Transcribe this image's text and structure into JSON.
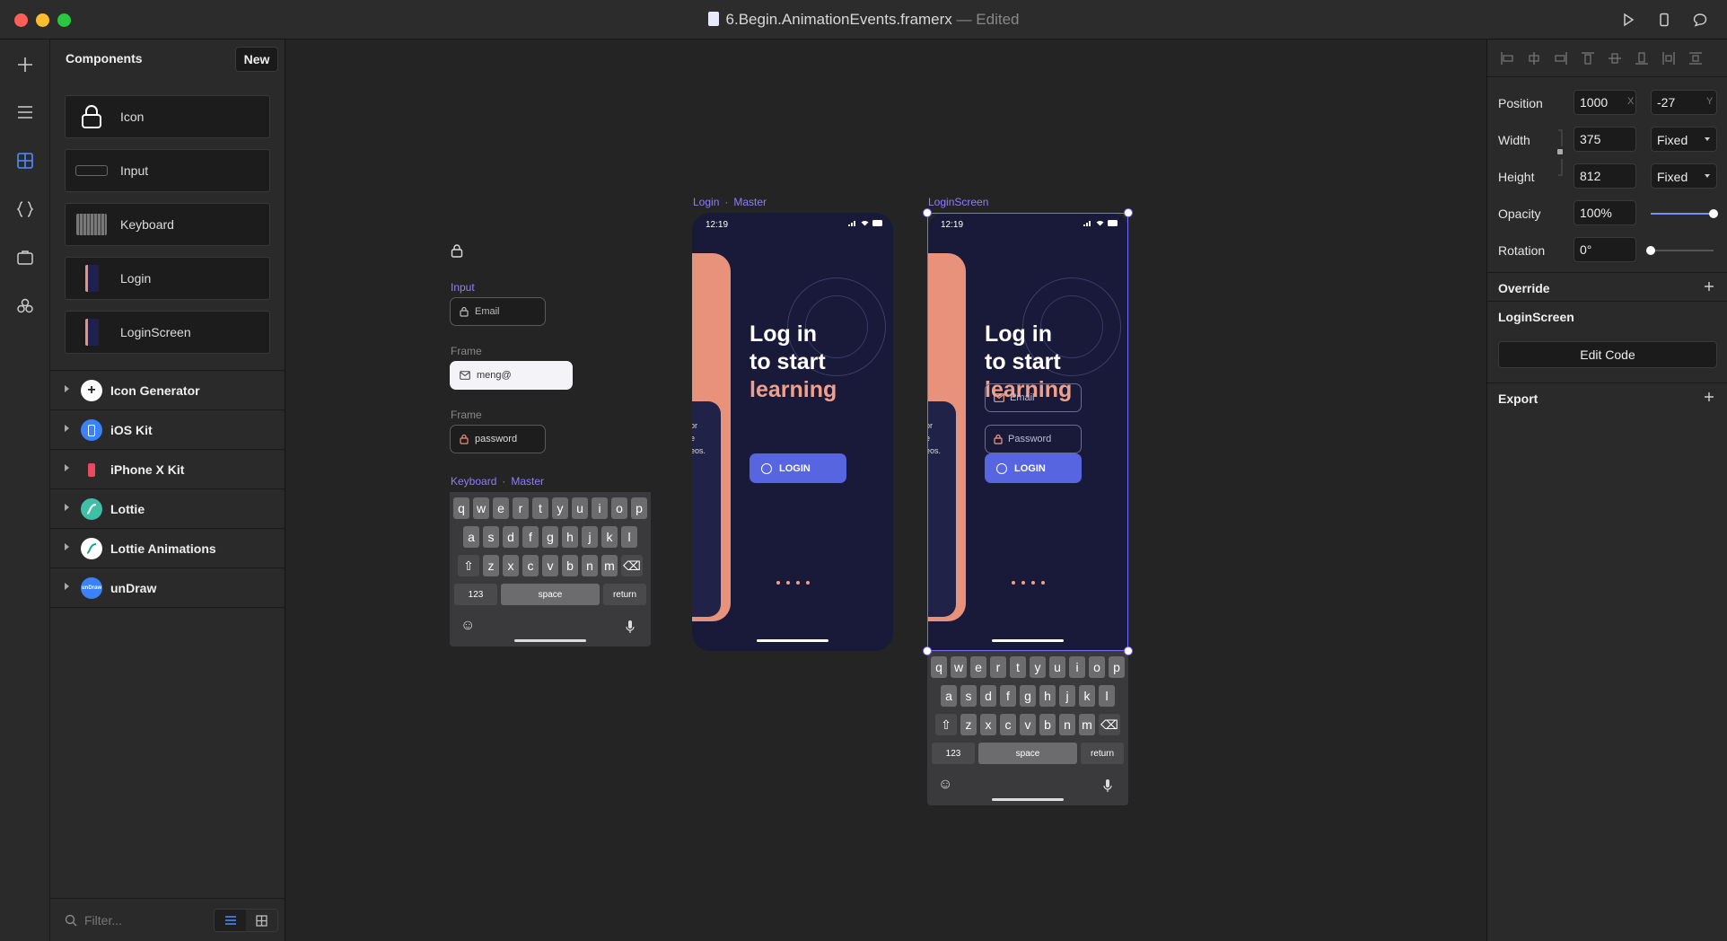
{
  "window": {
    "title": "6.Begin.AnimationEvents.framerx",
    "edited_suffix": "— Edited"
  },
  "components_panel": {
    "title": "Components",
    "new_label": "New",
    "items": [
      {
        "label": "Icon"
      },
      {
        "label": "Input"
      },
      {
        "label": "Keyboard"
      },
      {
        "label": "Login"
      },
      {
        "label": "LoginScreen"
      }
    ],
    "packages": [
      {
        "label": "Icon Generator",
        "icon_text": "+",
        "color": "#ffffff"
      },
      {
        "label": "iOS Kit",
        "icon_text": "",
        "color": "#3b82f6"
      },
      {
        "label": "iPhone X Kit",
        "icon_text": "",
        "color": "#2a2a2a"
      },
      {
        "label": "Lottie",
        "icon_text": "",
        "color": "#3fc0a6"
      },
      {
        "label": "Lottie Animations",
        "icon_text": "",
        "color": "#ffffff"
      },
      {
        "label": "unDraw",
        "icon_text": "unDraw",
        "color": "#3b82f6"
      }
    ],
    "filter_placeholder": "Filter..."
  },
  "canvas": {
    "input_label": "Input",
    "input_placeholder": "Email",
    "frame_label_1": "Frame",
    "frame_value_1": "meng@",
    "frame_label_2": "Frame",
    "frame_value_2": "password",
    "keyboard_label": "Keyboard",
    "keyboard_master": "Master",
    "login_label": "Login",
    "login_master": "Master",
    "loginscreen_label": "LoginScreen",
    "keys_row1": [
      "q",
      "w",
      "e",
      "r",
      "t",
      "y",
      "u",
      "i",
      "o",
      "p"
    ],
    "keys_row2": [
      "a",
      "s",
      "d",
      "f",
      "g",
      "h",
      "j",
      "k",
      "l"
    ],
    "keys_row3": [
      "z",
      "x",
      "c",
      "v",
      "b",
      "n",
      "m"
    ],
    "key_123": "123",
    "key_space": "space",
    "key_return": "return",
    "phone": {
      "time": "12:19",
      "line1": "Log in",
      "line2": "to start",
      "line3": "learning",
      "card_text_1": "or",
      "card_text_2": "e",
      "card_text_3": "eos.",
      "email_placeholder": "Email",
      "password_placeholder": "Password",
      "login_button": "LOGIN"
    }
  },
  "properties": {
    "position_label": "Position",
    "position_x": "1000",
    "position_y": "-27",
    "x_suffix": "X",
    "y_suffix": "Y",
    "width_label": "Width",
    "width_value": "375",
    "width_mode": "Fixed",
    "height_label": "Height",
    "height_value": "812",
    "height_mode": "Fixed",
    "opacity_label": "Opacity",
    "opacity_value": "100%",
    "opacity_fraction": 1.0,
    "rotation_label": "Rotation",
    "rotation_value": "0°",
    "rotation_fraction": 0.0,
    "override_label": "Override",
    "component_name": "LoginScreen",
    "edit_code_label": "Edit Code",
    "export_label": "Export"
  }
}
